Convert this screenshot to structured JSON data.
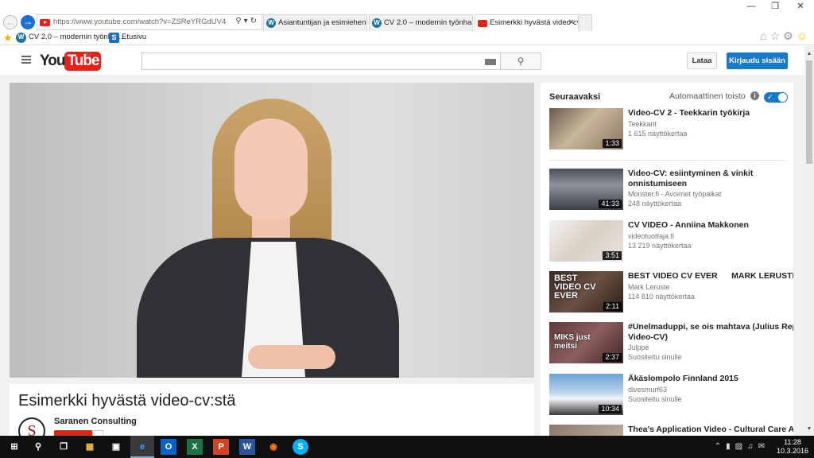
{
  "browser": {
    "url": "https://www.youtube.com/watch?v=ZSReYRGdUV4",
    "tabs": [
      {
        "label": "Asiantuntijan ja esimiehen työ...",
        "icon": "wordpress-icon",
        "active": false
      },
      {
        "label": "CV 2.0 – modernin työnhaun yt...",
        "icon": "wordpress-icon",
        "active": false
      },
      {
        "label": "Esimerkki hyvästä video-cvs...",
        "icon": "youtube-icon",
        "active": true
      }
    ],
    "favorites": [
      {
        "label": "CV 2.0 – modernin työnha...",
        "icon": "wordpress-icon"
      },
      {
        "label": "Etusivu",
        "icon": "skype-icon"
      }
    ]
  },
  "masthead": {
    "logo_you": "You",
    "logo_tube": "Tube",
    "country": "FI",
    "search_placeholder": "",
    "upload_label": "Lataa",
    "signin_label": "Kirjaudu sisään"
  },
  "video": {
    "title": "Esimerkki hyvästä video-cv:stä",
    "channel": "Saranen Consulting",
    "channel_initial": "S"
  },
  "sidebar": {
    "up_next": "Seuraavaksi",
    "autoplay": "Automaattinen toisto",
    "autoplay_on": true,
    "items": [
      {
        "title": "Video-CV 2 - Teekkarin työkirja",
        "channel": "Teekkarit",
        "meta": "1 615 näyttökertaa",
        "duration": "1:33",
        "overlay": ""
      },
      {
        "title": "Video-CV: esiintyminen & vinkit\nonnistumiseen",
        "channel": "Monster.fi - Avoimet työpaikat",
        "meta": "248 näyttökertaa",
        "duration": "41:33",
        "overlay": ""
      },
      {
        "title": "CV VIDEO - Anniina Makkonen",
        "channel": "videotuottaja.fi",
        "meta": "13 219 näyttökertaa",
        "duration": "3:51",
        "overlay": ""
      },
      {
        "title": "BEST VIDEO CV EVER      MARK LERUSTE",
        "channel": "Mark Leruste",
        "meta": "114 810 näyttökertaa",
        "duration": "2:11",
        "overlay": "BEST\nVIDEO CV\nEVER"
      },
      {
        "title": "#Unelmaduppi, se ois mahtava (Julius Repo\nVideo-CV)",
        "channel": "Julppe",
        "meta": "Suositeltu sinulle",
        "duration": "2:37",
        "overlay": "MIKS just\nmeitsi"
      },
      {
        "title": "Äkäslompolo Finnland 2015",
        "channel": "divesmurf63",
        "meta": "Suositeltu sinulle",
        "duration": "10:34",
        "overlay": ""
      },
      {
        "title": "Thea's Application Video - Cultural Care Au",
        "channel": "",
        "meta": "",
        "duration": "",
        "overlay": ""
      }
    ]
  },
  "taskbar": {
    "time": "11:28",
    "date": "10.3.2016"
  }
}
